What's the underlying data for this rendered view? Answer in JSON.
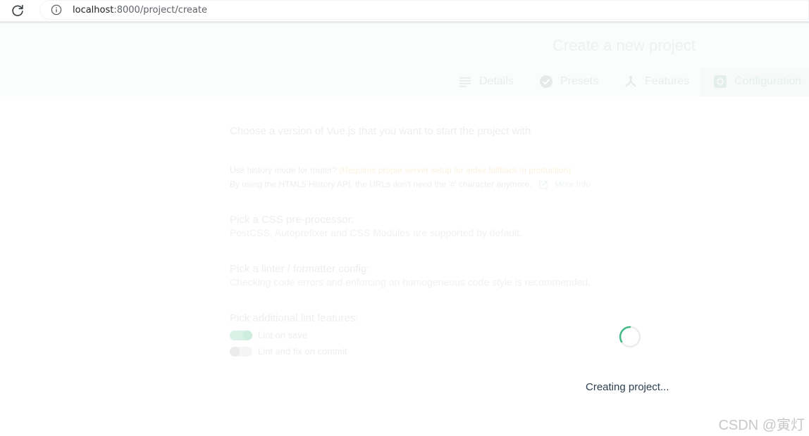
{
  "browser": {
    "url_host": "localhost",
    "url_rest": ":8000/project/create"
  },
  "header": {
    "title": "Create a new project",
    "tabs": [
      {
        "label": "Details",
        "icon": "list-icon"
      },
      {
        "label": "Presets",
        "icon": "check-circle-icon"
      },
      {
        "label": "Features",
        "icon": "fork-icon"
      },
      {
        "label": "Configuration",
        "icon": "settings-square-icon",
        "active": true
      }
    ]
  },
  "form": {
    "vue_version_prompt": "Choose a version of Vue.js that you want to start the project with",
    "history_mode": {
      "label": "Use history mode for router?",
      "warning": "(Requires proper server setup for index fallback in production)",
      "description": "By using the HTML5 History API, the URLs don't need the '#' character anymore.",
      "more_info": "More Info"
    },
    "css_preprocessor": {
      "title": "Pick a CSS pre-processor:",
      "description": "PostCSS, Autoprefixer and CSS Modules are supported by default."
    },
    "linter": {
      "title": "Pick a linter / formatter config:",
      "description": "Checking code errors and enforcing an homogeneous code style is recommended."
    },
    "lint_features": {
      "title": "Pick additional lint features:",
      "options": [
        {
          "label": "Lint on save",
          "enabled": true
        },
        {
          "label": "Lint and fix on commit",
          "enabled": false
        }
      ]
    }
  },
  "loading": {
    "text": "Creating project..."
  },
  "watermark": "CSDN @寅灯",
  "colors": {
    "accent": "#42b983",
    "text_dark": "#2c3e50"
  }
}
